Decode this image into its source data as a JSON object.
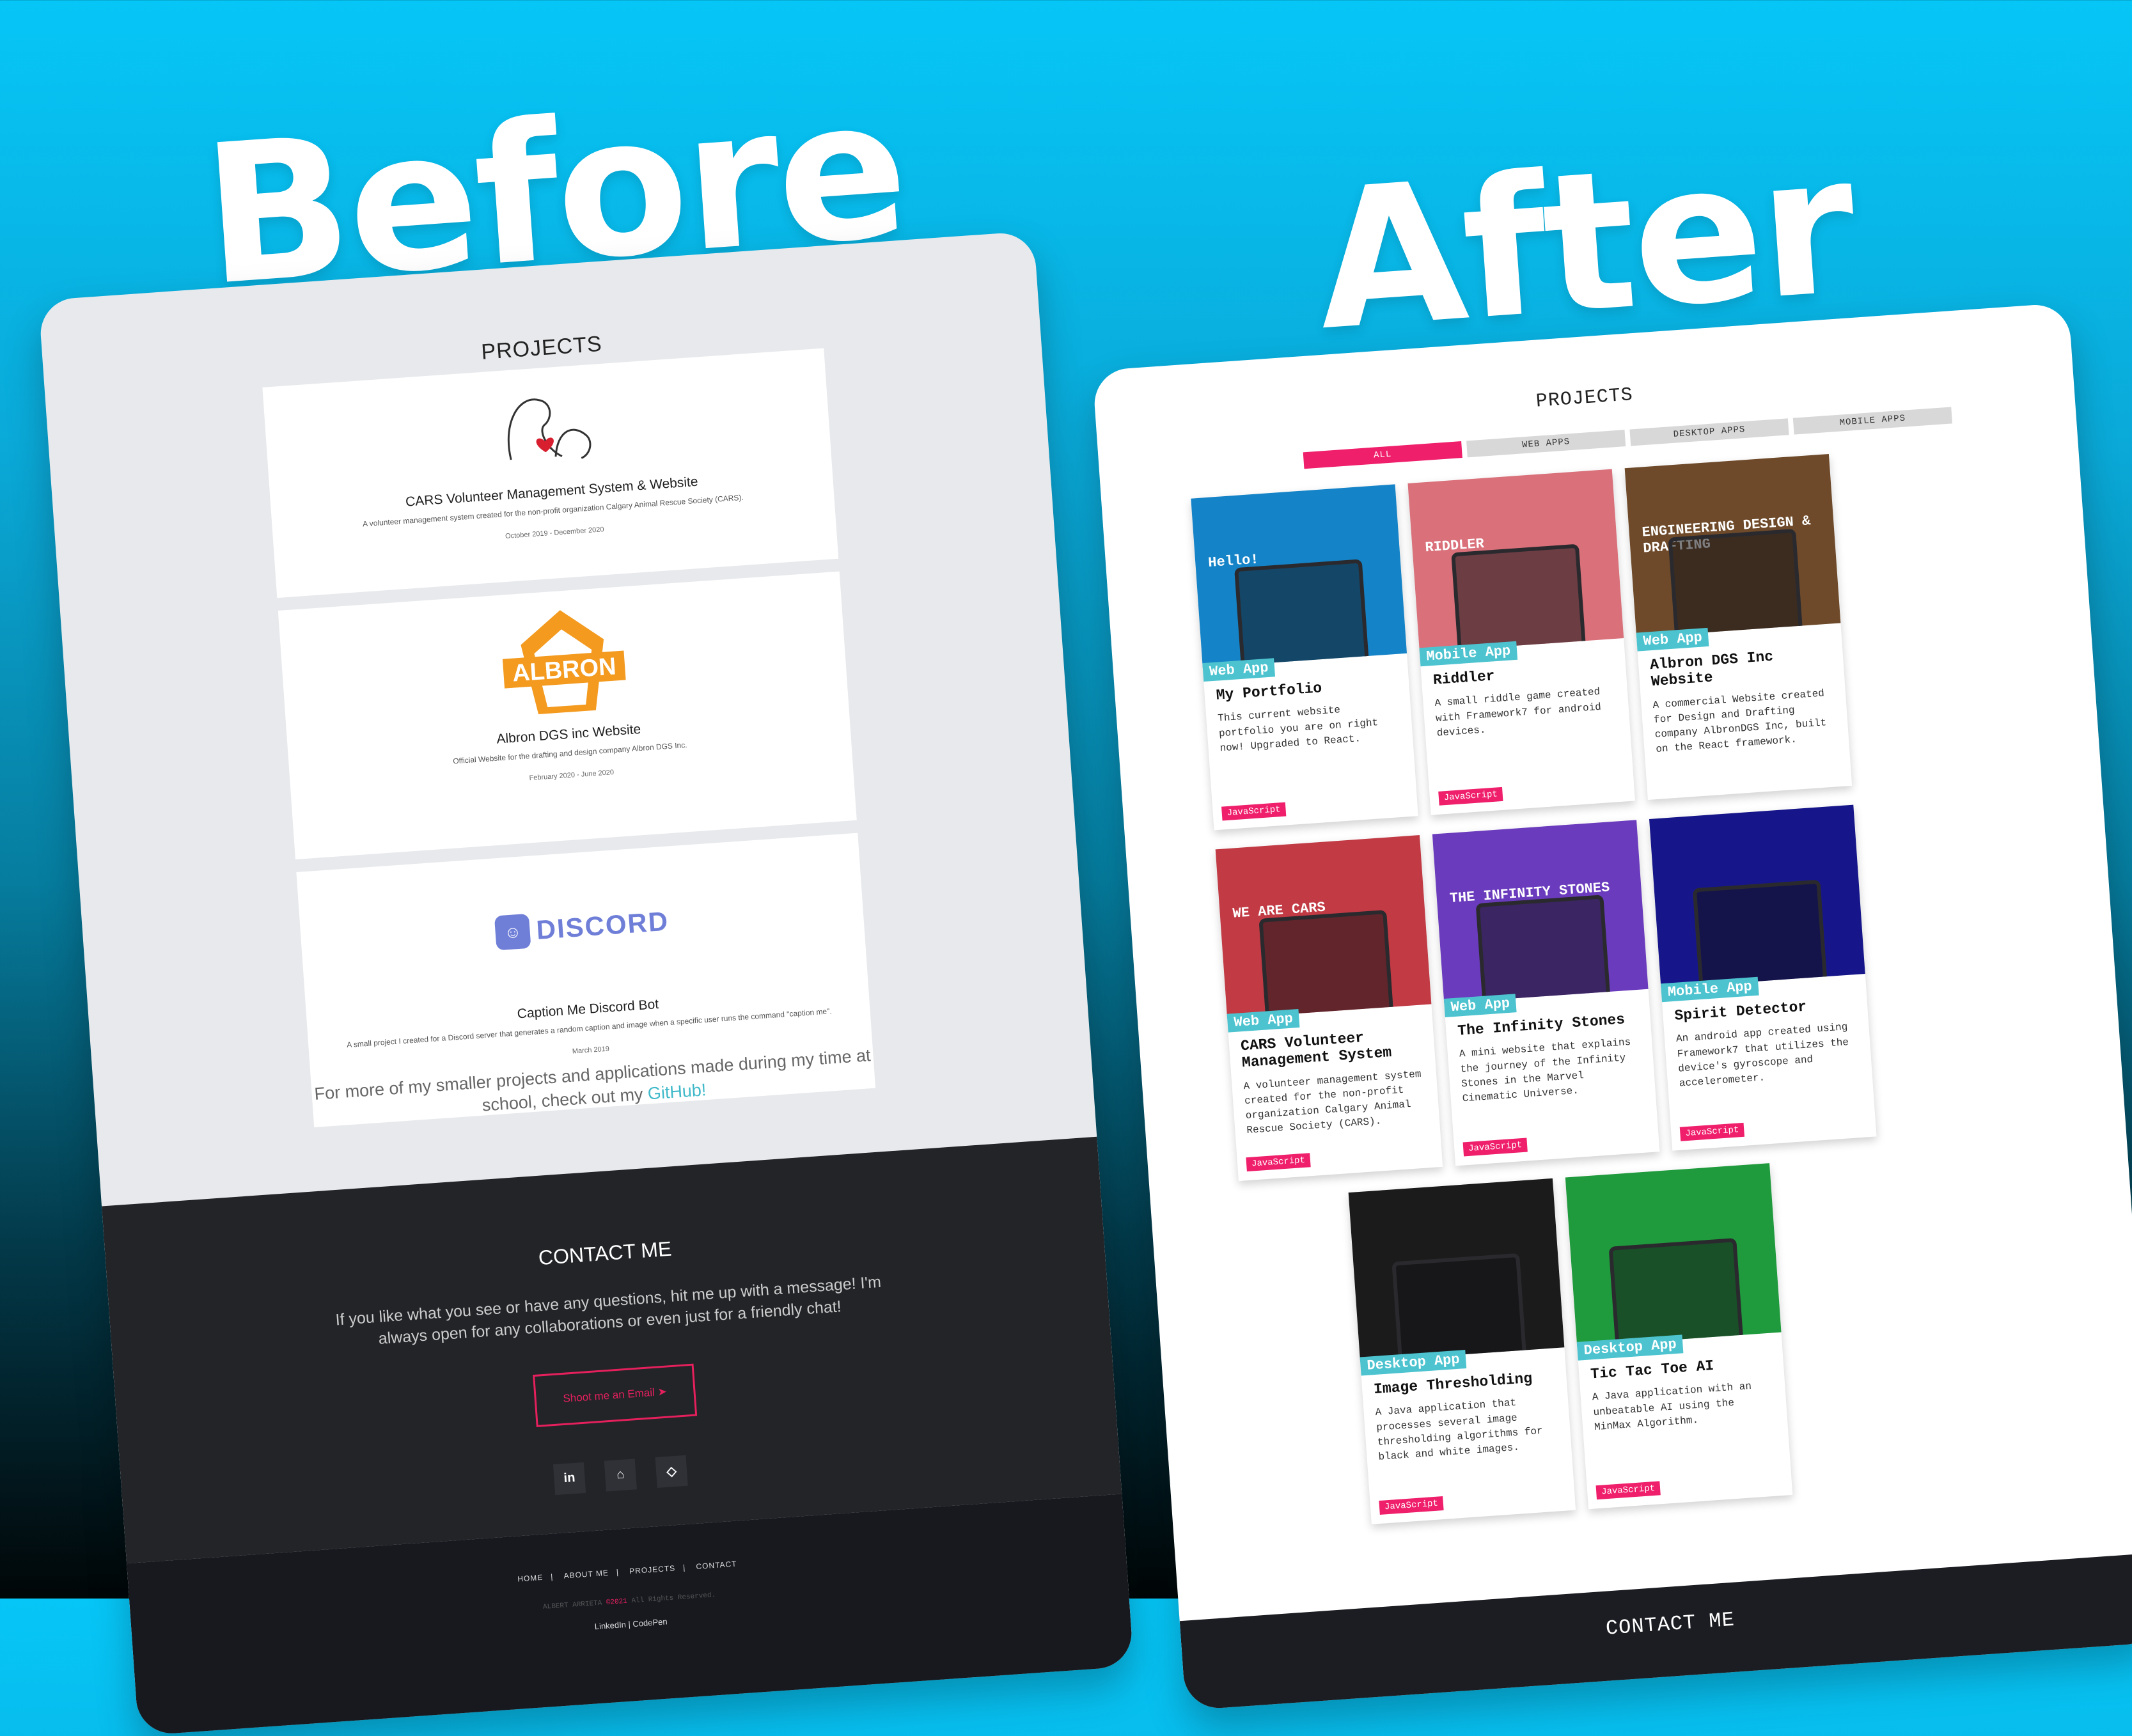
{
  "headlines": {
    "before": "Before",
    "after": "After"
  },
  "before": {
    "title": "PROJECTS",
    "cards": [
      {
        "logo": "dog-cat-heart-logo",
        "title": "CARS Volunteer Management System & Website",
        "desc": "A volunteer management system created for the non-profit organization Calgary Animal Rescue Society (CARS).",
        "date": "October 2019 - December 2020"
      },
      {
        "logo": "ALBRON",
        "title": "Albron DGS inc Website",
        "desc": "Official Website for the drafting and design company Albron DGS Inc.",
        "date": "February 2020 - June 2020"
      },
      {
        "logo": "DISCORD",
        "title": "Caption Me Discord Bot",
        "desc": "A small project I created for a Discord server that generates a random caption and image when a specific user runs the command \"caption me\".",
        "date": "March 2019"
      }
    ],
    "more_text": "For more of my smaller projects and applications made during my time at school, check out my",
    "github_link": "GitHub!",
    "contact": {
      "title": "CONTACT ME",
      "text": "If you like what you see or have any questions, hit me up with a message! I'm always open for any collaborations or even just for a friendly chat!",
      "email_button": "Shoot me an Email",
      "email_icon": "➤",
      "social": [
        "in",
        "⌂",
        "◇"
      ]
    },
    "footer": {
      "nav": [
        "HOME",
        "ABOUT ME",
        "PROJECTS",
        "CONTACT"
      ],
      "copy_prefix": "ALBERT ARRIETA ",
      "copy_year": "©2021",
      "copy_suffix": " All Rights Reserved.",
      "links": "LinkedIn | CodePen"
    }
  },
  "after": {
    "title": "PROJECTS",
    "tabs": [
      "ALL",
      "WEB APPS",
      "DESKTOP APPS",
      "MOBILE APPS"
    ],
    "cards": [
      {
        "kind": "Web App",
        "title": "My Portfolio",
        "desc": "This current website portfolio you are on right now! Upgraded to React.",
        "tag": "JavaScript",
        "thumb_color": "#1583c7",
        "thumb_text": "Hello!"
      },
      {
        "kind": "Mobile App",
        "title": "Riddler",
        "desc": "A small riddle game created with Framework7 for android devices.",
        "tag": "JavaScript",
        "thumb_color": "#d9707a",
        "thumb_text": "RIDDLER"
      },
      {
        "kind": "Web App",
        "title": "Albron DGS Inc Website",
        "desc": "A commercial Website created for Design and Drafting company AlbronDGS Inc, built on the React framework.",
        "tag": "",
        "thumb_color": "#6e4a2a",
        "thumb_text": "ENGINEERING DESIGN & DRAFTING"
      },
      {
        "kind": "Web App",
        "title": "CARS Volunteer Management System",
        "desc": "A volunteer management system created for the non-profit organization Calgary Animal Rescue Society (CARS).",
        "tag": "JavaScript",
        "thumb_color": "#c13a44",
        "thumb_text": "WE ARE CARS"
      },
      {
        "kind": "Web App",
        "title": "The Infinity Stones",
        "desc": "A mini website that explains the journey of the Infinity Stones in the Marvel Cinematic Universe.",
        "tag": "JavaScript",
        "thumb_color": "#6a3bbd",
        "thumb_text": "THE INFINITY STONES"
      },
      {
        "kind": "Mobile App",
        "title": "Spirit Detector",
        "desc": "An android app created using Framework7 that utilizes the device's gyroscope and accelerometer.",
        "tag": "JavaScript",
        "thumb_color": "#16168a",
        "thumb_text": ""
      },
      {
        "kind": "Desktop App",
        "title": "Image Thresholding",
        "desc": "A Java application that processes several image thresholding algorithms for black and white images.",
        "tag": "JavaScript",
        "thumb_color": "#1b1b1b",
        "thumb_text": ""
      },
      {
        "kind": "Desktop App",
        "title": "Tic Tac Toe AI",
        "desc": "A Java application with an unbeatable AI using the MinMax Algorithm.",
        "tag": "JavaScript",
        "thumb_color": "#1f9a3c",
        "thumb_text": ""
      }
    ],
    "contact_title": "CONTACT ME"
  }
}
